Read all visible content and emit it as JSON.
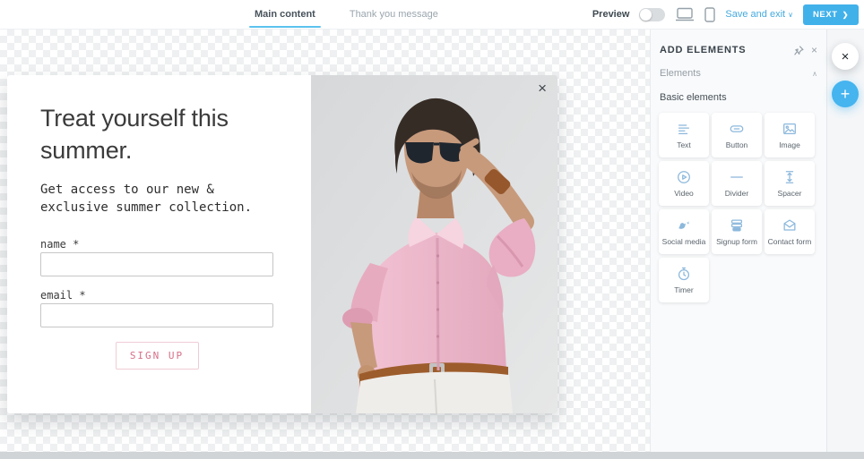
{
  "topbar": {
    "tabs": [
      {
        "label": "Main content"
      },
      {
        "label": "Thank you message"
      }
    ],
    "preview_label": "Preview",
    "save_and_exit_label": "Save and exit",
    "save_chevron": "∨",
    "next_label": "NEXT",
    "next_arrow": "❯"
  },
  "popup": {
    "heading": "Treat yourself this summer.",
    "subtext": "Get access to our new & exclusive summer collection.",
    "name_label": "name *",
    "email_label": "email *",
    "submit_label": "SIGN UP",
    "close_glyph": "×"
  },
  "sidebar": {
    "title": "ADD ELEMENTS",
    "close_glyph": "×",
    "section_label": "Elements",
    "section_chevron": "∧",
    "group_label": "Basic elements",
    "cards": [
      {
        "label": "Text"
      },
      {
        "label": "Button"
      },
      {
        "label": "Image"
      },
      {
        "label": "Video"
      },
      {
        "label": "Divider"
      },
      {
        "label": "Spacer"
      },
      {
        "label": "Social media"
      },
      {
        "label": "Signup form"
      },
      {
        "label": "Contact form"
      },
      {
        "label": "Timer"
      }
    ]
  },
  "fabs": {
    "close_glyph": "×",
    "add_glyph": "+"
  },
  "colors": {
    "accent_blue": "#41b1ea",
    "link_blue": "#45aadf",
    "tab_underline": "#5bc2ef",
    "icon_blue": "#8cb8dc",
    "signup_pink": "#d86f88"
  }
}
